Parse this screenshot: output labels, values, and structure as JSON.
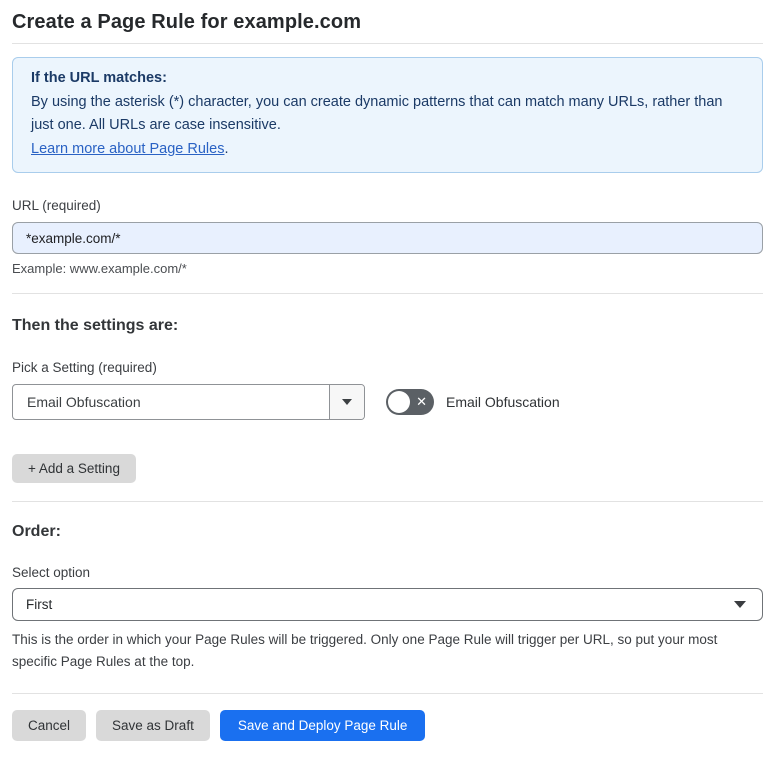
{
  "page": {
    "title": "Create a Page Rule for example.com"
  },
  "info_box": {
    "heading": "If the URL matches:",
    "body": "By using the asterisk (*) character, you can create dynamic patterns that can match many URLs, rather than just one. All URLs are case insensitive.",
    "link_label": "Learn more about Page Rules",
    "link_suffix": "."
  },
  "url_section": {
    "label": "URL (required)",
    "value": "*example.com/*",
    "example": "Example: www.example.com/*"
  },
  "settings_section": {
    "heading": "Then the settings are:",
    "pick_label": "Pick a Setting (required)",
    "selected_setting": "Email Obfuscation",
    "toggle_label": "Email Obfuscation",
    "toggle_state": "off",
    "add_setting_label": "+ Add a Setting"
  },
  "order_section": {
    "heading": "Order:",
    "select_label": "Select option",
    "selected_option": "First",
    "help_text": "This is the order in which your Page Rules will be triggered. Only one Page Rule will trigger per URL, so put your most specific Page Rules at the top."
  },
  "footer": {
    "cancel_label": "Cancel",
    "save_draft_label": "Save as Draft",
    "save_deploy_label": "Save and Deploy Page Rule"
  },
  "icons": {
    "toggle_off_x": "✕"
  },
  "colors": {
    "accent_blue": "#1a70f0",
    "info_bg": "#ecf5fd",
    "info_border": "#a9cdec",
    "info_text": "#1b3a66",
    "link_blue": "#2a62c4",
    "input_autofill_bg": "#e8f0fe",
    "button_gray": "#d9d9d9",
    "toggle_off_gray": "#5b6065"
  }
}
